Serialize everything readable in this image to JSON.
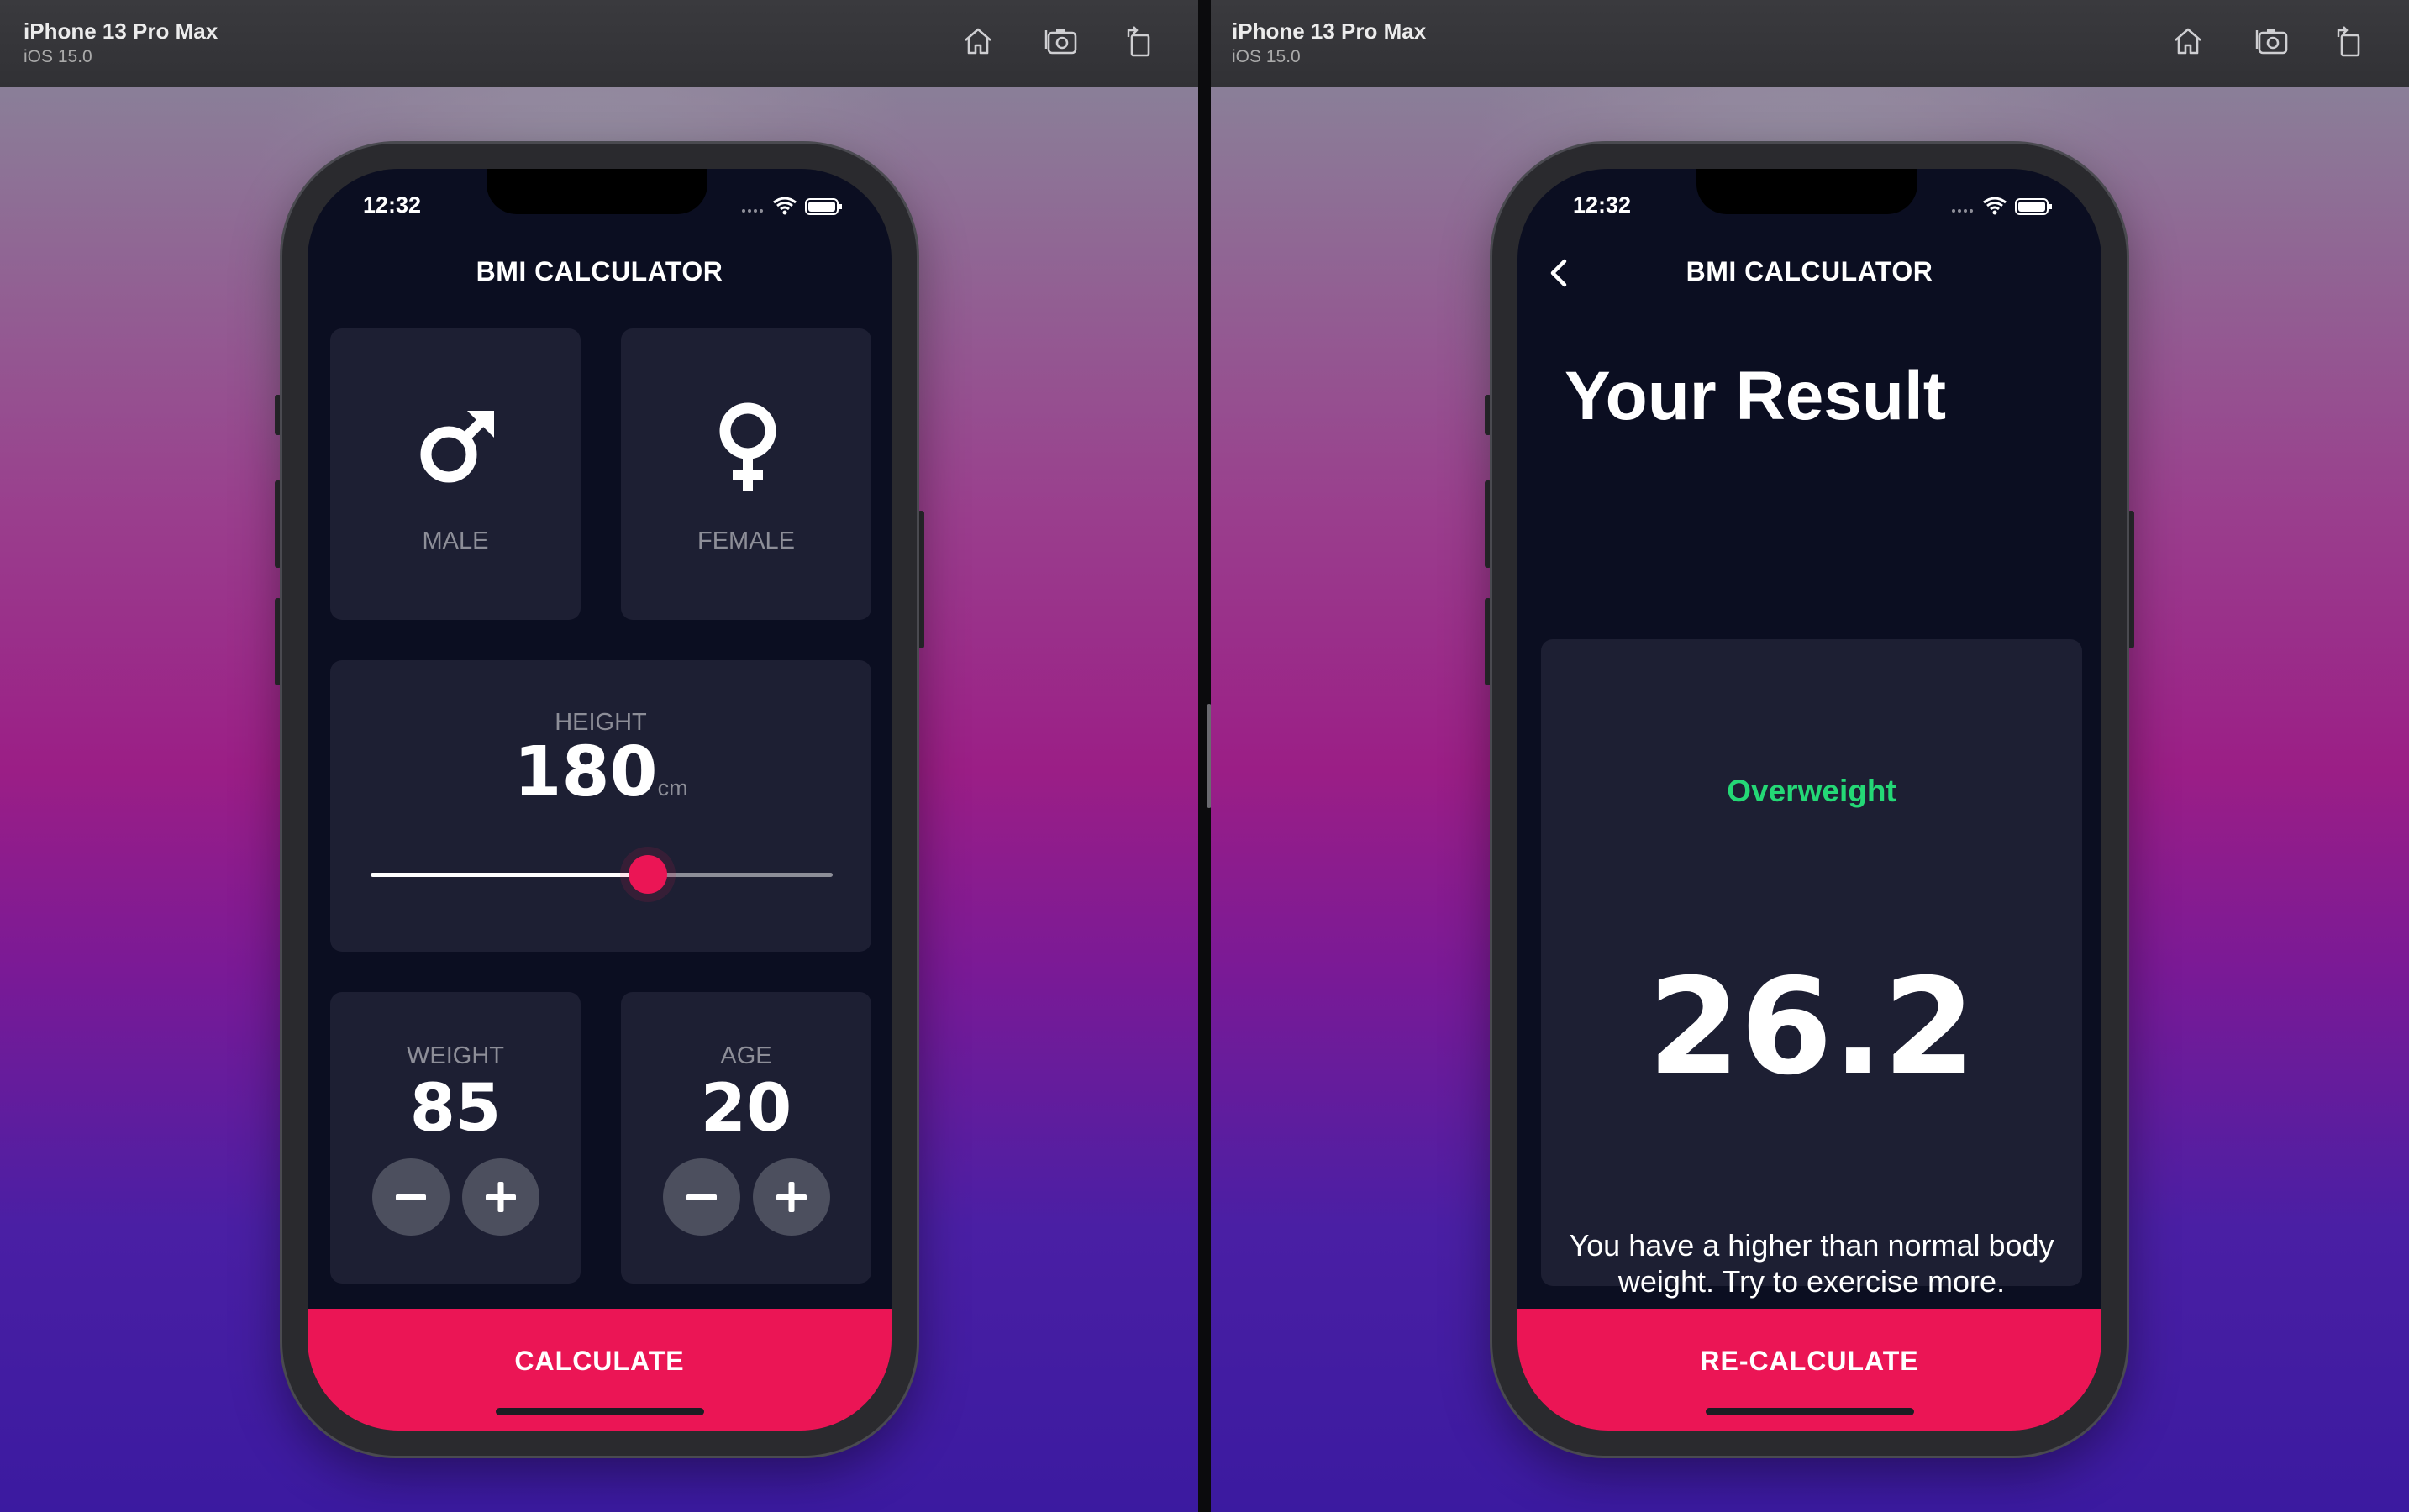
{
  "left": {
    "titlebar": {
      "device_name": "iPhone 13 Pro Max",
      "os_version": "iOS 15.0"
    },
    "status_time": "12:32",
    "app_title": "BMI CALCULATOR",
    "gender": {
      "male_label": "MALE",
      "female_label": "FEMALE",
      "male_icon": "male-symbol-icon",
      "female_icon": "female-symbol-icon"
    },
    "height": {
      "label": "HEIGHT",
      "value": "180",
      "unit": "cm",
      "slider_fraction": 0.6
    },
    "weight": {
      "label": "WEIGHT",
      "value": "85"
    },
    "age": {
      "label": "AGE",
      "value": "20"
    },
    "button_label": "CALCULATE"
  },
  "right": {
    "titlebar": {
      "device_name": "iPhone 13 Pro Max",
      "os_version": "iOS 15.0"
    },
    "status_time": "12:32",
    "app_title": "BMI CALCULATOR",
    "result_title": "Your Result",
    "status": "Overweight",
    "bmi_value": "26.2",
    "message": "You have a higher than normal body weight. Try to exercise more.",
    "button_label": "RE-CALCULATE"
  },
  "colors": {
    "accent": "#eb1555",
    "background": "#0b0e21",
    "card": "#1d1f33",
    "status_green": "#24d876",
    "secondary_text": "#8d8e98"
  },
  "toolbar_icons": [
    "home-icon",
    "screenshot-icon",
    "rotate-icon"
  ]
}
